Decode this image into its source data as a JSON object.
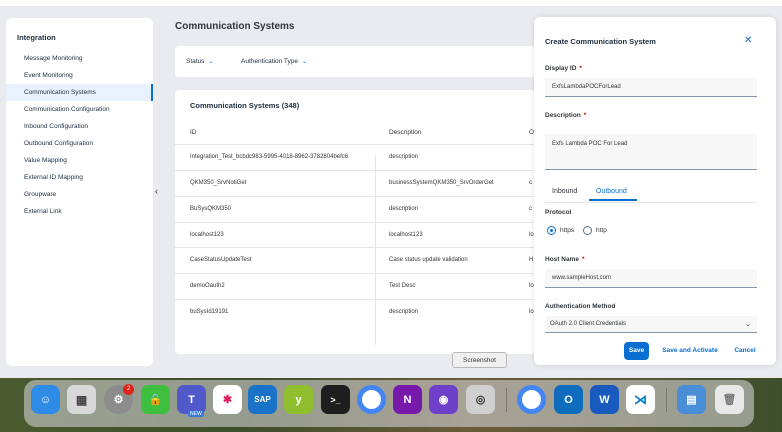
{
  "sidebar": {
    "title": "Integration",
    "items": [
      {
        "label": "Message Monitoring"
      },
      {
        "label": "Event Monitoring"
      },
      {
        "label": "Communication Systems"
      },
      {
        "label": "Communication Configuration"
      },
      {
        "label": "Inbound Configuration"
      },
      {
        "label": "Outbound Configuration"
      },
      {
        "label": "Value Mapping"
      },
      {
        "label": "External ID Mapping"
      },
      {
        "label": "Groupware"
      },
      {
        "label": "External Link"
      }
    ],
    "collapse_glyph": "‹"
  },
  "page": {
    "title": "Communication Systems",
    "filters": {
      "status": "Status",
      "auth": "Authentication Type"
    }
  },
  "table": {
    "title": "Communication Systems (348)",
    "headers": {
      "id": "ID",
      "description": "Description",
      "third": "O"
    },
    "rows": [
      {
        "id": "Integration_Test_bcbdc983-5995-4018-8962-3782804befc6",
        "description": "description",
        "c3": ""
      },
      {
        "id": "QKM350_SrvNotiGet",
        "description": "businessSystemQKM350_SrvOrderGet",
        "c3": "c"
      },
      {
        "id": "BuSysQKM350",
        "description": "description",
        "c3": "c"
      },
      {
        "id": "localhost123",
        "description": "localhost123",
        "c3": "lo"
      },
      {
        "id": "CaseStatusUpdateTest",
        "description": "Case status update validation",
        "c3": "H"
      },
      {
        "id": "demoOauth2",
        "description": "Test Desc",
        "c3": "lo"
      },
      {
        "id": "buSysId19191",
        "description": "description",
        "c3": "lo"
      }
    ]
  },
  "panel": {
    "title": "Create Communication System",
    "close_glyph": "✕",
    "display_id_label": "Display ID",
    "display_id_value": "ExfsLambdaPOCForLead",
    "description_label": "Description",
    "description_value": "Exfs Lambda POC For Lead",
    "required_mark": "*",
    "tabs": {
      "inbound": "Inbound",
      "outbound": "Outbound"
    },
    "protocol_label": "Protocol",
    "protocol_https": "https",
    "protocol_http": "http",
    "host_label": "Host Name",
    "host_value": "www.sampleHost.com",
    "auth_label": "Authentication Method",
    "auth_value": "OAuth 2.0 Client Credentials",
    "buttons": {
      "save": "Save",
      "save_activate": "Save and Activate",
      "cancel": "Cancel"
    }
  },
  "tooltip": "Screenshot",
  "dock": {
    "items": [
      {
        "name": "finder"
      },
      {
        "name": "launchpad"
      },
      {
        "name": "system-settings",
        "badge": "2"
      },
      {
        "name": "password-app"
      },
      {
        "name": "teams",
        "tag": "NEW"
      },
      {
        "name": "slack"
      },
      {
        "name": "sap"
      },
      {
        "name": "yubico"
      },
      {
        "name": "terminal"
      },
      {
        "name": "chrome"
      },
      {
        "name": "onenote"
      },
      {
        "name": "github"
      },
      {
        "name": "screenshot"
      },
      {
        "name": "chrome-2"
      },
      {
        "name": "outlook"
      },
      {
        "name": "word"
      },
      {
        "name": "vscode"
      },
      {
        "name": "folder"
      },
      {
        "name": "trash"
      }
    ]
  },
  "colors": {
    "accent": "#0a6ed1",
    "required": "#bb0000"
  }
}
